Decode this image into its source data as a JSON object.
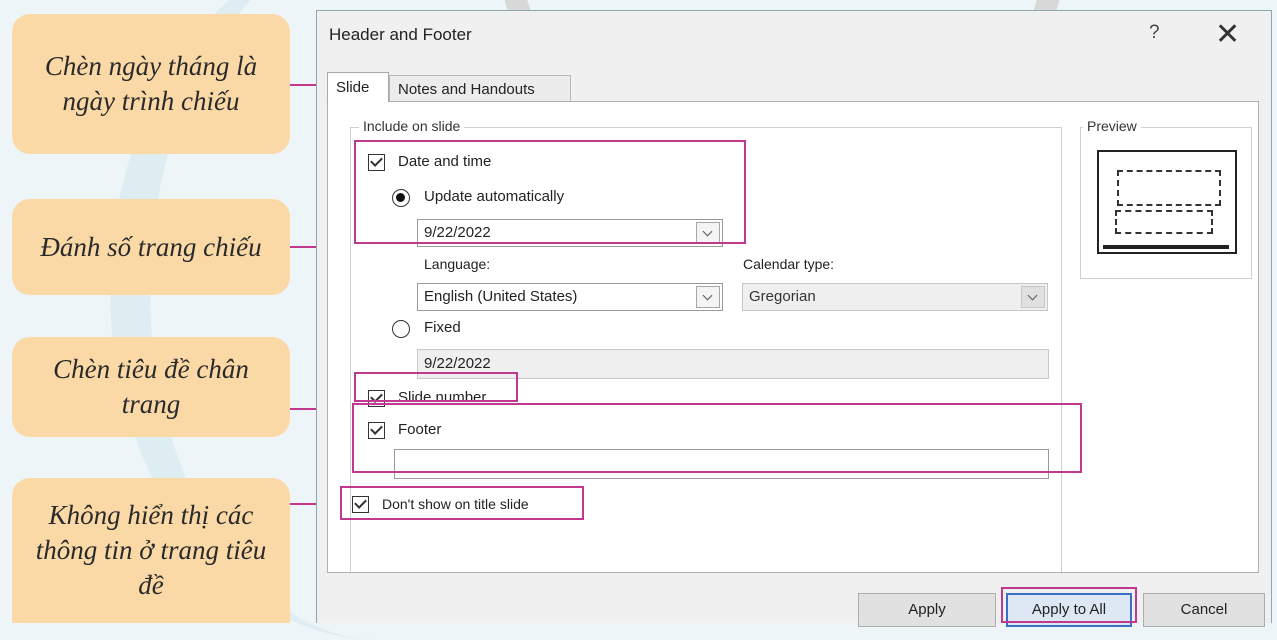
{
  "callouts": [
    "Chèn ngày tháng là ngày trình chiếu",
    "Đánh số trang chiếu",
    "Chèn tiêu đề chân trang",
    "Không hiển thị các thông tin ở trang tiêu đề"
  ],
  "dialog": {
    "title": "Header and Footer",
    "help": "?",
    "close": "✕",
    "tabs": [
      "Slide",
      "Notes and Handouts"
    ],
    "include_group": "Include on slide",
    "date_time": {
      "label": "Date and time",
      "checked": true
    },
    "update_auto": {
      "label": "Update automatically",
      "selected": true
    },
    "update_date": "9/22/2022",
    "language_label": "Language:",
    "language_value": "English (United States)",
    "calendar_label": "Calendar type:",
    "calendar_value": "Gregorian",
    "fixed": {
      "label": "Fixed",
      "selected": false
    },
    "fixed_value": "9/22/2022",
    "slide_number": {
      "label": "Slide number",
      "checked": true
    },
    "footer": {
      "label": "Footer",
      "checked": true,
      "value": ""
    },
    "dont_show": {
      "label": "Don't show on title slide",
      "checked": true
    },
    "preview_label": "Preview",
    "buttons": {
      "apply": "Apply",
      "apply_all": "Apply to All",
      "cancel": "Cancel"
    }
  },
  "colors": {
    "highlight": "#c0398f",
    "callout_bg": "#fbd9a7",
    "primary_border": "#3b6fc3"
  }
}
